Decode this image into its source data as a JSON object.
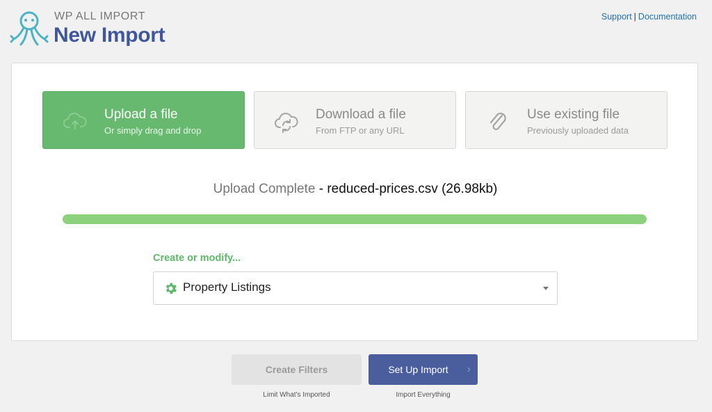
{
  "header": {
    "brand_name": "WP ALL IMPORT",
    "title": "New Import",
    "support_link": "Support",
    "separator": "|",
    "documentation_link": "Documentation",
    "logo_icon": "octopus-logo-icon"
  },
  "upload_options": [
    {
      "title": "Upload a file",
      "subtitle": "Or simply drag and drop",
      "icon": "cloud-upload-icon",
      "active": true
    },
    {
      "title": "Download a file",
      "subtitle": "From FTP or any URL",
      "icon": "cloud-download-icon",
      "active": false
    },
    {
      "title": "Use existing file",
      "subtitle": "Previously uploaded data",
      "icon": "paperclip-icon",
      "active": false
    }
  ],
  "status": {
    "label": "Upload Complete",
    "separator": " - ",
    "filename": "reduced-prices.csv (26.98kb)",
    "progress_percent": 100
  },
  "post_type": {
    "label": "Create or modify...",
    "selected": "Property Listings",
    "icon": "gear-icon"
  },
  "actions": {
    "create_filters_label": "Create Filters",
    "create_filters_sub": "Limit What's Imported",
    "setup_import_label": "Set Up Import",
    "setup_import_sub": "Import Everything"
  },
  "colors": {
    "accent_green": "#66b96e",
    "brand_blue": "#40579a",
    "button_blue": "#4a5d9d",
    "progress_green": "#8cd17d",
    "link_blue": "#2271b1"
  }
}
